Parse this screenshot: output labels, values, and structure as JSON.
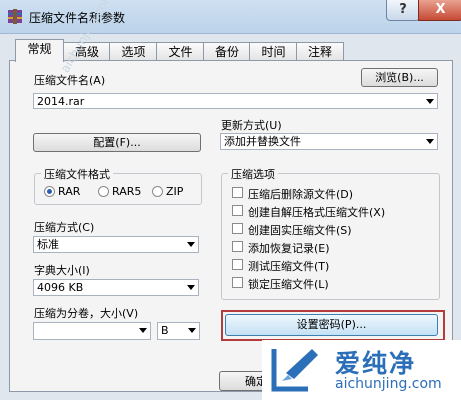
{
  "window": {
    "title": "压缩文件名和参数",
    "help_symbol": "?",
    "close_symbol": "X",
    "icon": "winrar-archive-icon"
  },
  "tabs": [
    "常规",
    "高级",
    "选项",
    "文件",
    "备份",
    "时间",
    "注释"
  ],
  "active_tab": "常规",
  "archive_name": {
    "label": "压缩文件名(A)",
    "browse_button": "浏览(B)...",
    "value": "2014.rar"
  },
  "update_mode": {
    "label": "更新方式(U)",
    "value": "添加并替换文件"
  },
  "profiles_button": "配置(F)...",
  "archive_format": {
    "title": "压缩文件格式",
    "options": [
      "RAR",
      "RAR5",
      "ZIP"
    ],
    "selected": "RAR"
  },
  "compression_method": {
    "label": "压缩方式(C)",
    "value": "标准"
  },
  "dictionary_size": {
    "label": "字典大小(I)",
    "value": "4096 KB"
  },
  "split_volumes": {
    "label": "压缩为分卷，大小(V)",
    "value": "",
    "unit": "B"
  },
  "archiving_options": {
    "title": "压缩选项",
    "items": [
      {
        "label": "压缩后删除源文件(D)",
        "checked": false
      },
      {
        "label": "创建自解压格式压缩文件(X)",
        "checked": false
      },
      {
        "label": "创建固实压缩文件(S)",
        "checked": false
      },
      {
        "label": "添加恢复记录(E)",
        "checked": false
      },
      {
        "label": "测试压缩文件(T)",
        "checked": false
      },
      {
        "label": "锁定压缩文件(L)",
        "checked": false
      }
    ]
  },
  "set_password_button": "设置密码(P)...",
  "ok_button": "确定",
  "watermark": {
    "main": "爱纯净",
    "url": "aichunjing.com",
    "faint_url": "aichunjing.com"
  },
  "colors": {
    "highlight_border": "#b23b3b",
    "watermark_blue": "#2b6fb8",
    "close_red": "#c64a34"
  }
}
